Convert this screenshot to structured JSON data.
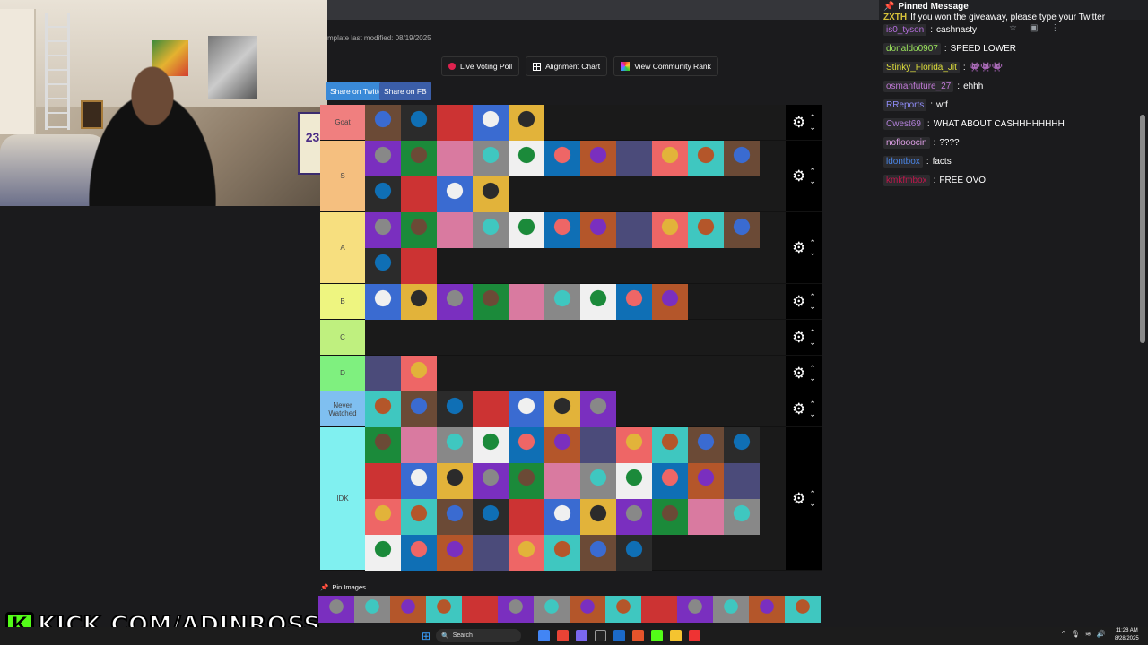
{
  "template_note": "mplate last modified: 08/19/2025",
  "buttons": {
    "live_poll": "Live Voting Poll",
    "alignment": "Alignment Chart",
    "community": "View Community Rank",
    "share_twitter": "Share on Twitter",
    "share_fb": "Share on FB"
  },
  "tiers": [
    {
      "label": "Goat",
      "color": "#f07f7f",
      "count": 5
    },
    {
      "label": "S",
      "color": "#f5bf7f",
      "count": 15
    },
    {
      "label": "A",
      "color": "#f7df7f",
      "count": 13
    },
    {
      "label": "B",
      "color": "#eef580",
      "count": 9
    },
    {
      "label": "C",
      "color": "#bff07f",
      "count": 0
    },
    {
      "label": "D",
      "color": "#7ff07f",
      "count": 2
    },
    {
      "label": "Never Watched",
      "color": "#7fbff0",
      "count": 7
    },
    {
      "label": "IDK",
      "color": "#80f0f0",
      "count": 41
    }
  ],
  "pin_images_label": "Pin Images",
  "pin_images_count": 14,
  "pinned": {
    "title": "Pinned Message",
    "user": "ZXTH",
    "text": "If you won the giveaway, please type your Twitter"
  },
  "chat": [
    {
      "user": "is0_tyson",
      "text": "cashnasty",
      "color": "#b76fe0"
    },
    {
      "user": "donaldo0907",
      "text": "SPEED LOWER",
      "color": "#9ce65c"
    },
    {
      "user": "Stinky_Florida_Jit",
      "text": "👾👾👾",
      "color": "#dede3a"
    },
    {
      "user": "osmanfuture_27",
      "text": "ehhh",
      "color": "#c07ad6"
    },
    {
      "user": "RReports",
      "text": "wtf",
      "color": "#8f8cf7"
    },
    {
      "user": "Cwest69",
      "text": "WHAT ABOUT CASHHHHHHHH",
      "color": "#b07fd8"
    },
    {
      "user": "noflooocin",
      "text": "????",
      "color": "#e0a0e8"
    },
    {
      "user": "ldontbox",
      "text": "facts",
      "color": "#4a86e8"
    },
    {
      "user": "kmkfmbox",
      "text": "FREE OVO",
      "color": "#c0174d"
    }
  ],
  "search_placeholder": "Search",
  "clock": {
    "time": "11:28 AM",
    "date": "8/28/2025"
  },
  "brand": "KICK.COM/ADINROSS",
  "brand_mark": "K",
  "jersey_number": "23",
  "icons": {
    "settings": "gear-icon",
    "up": "chevron-up-icon",
    "down": "chevron-down-icon",
    "pin": "pin-icon"
  }
}
